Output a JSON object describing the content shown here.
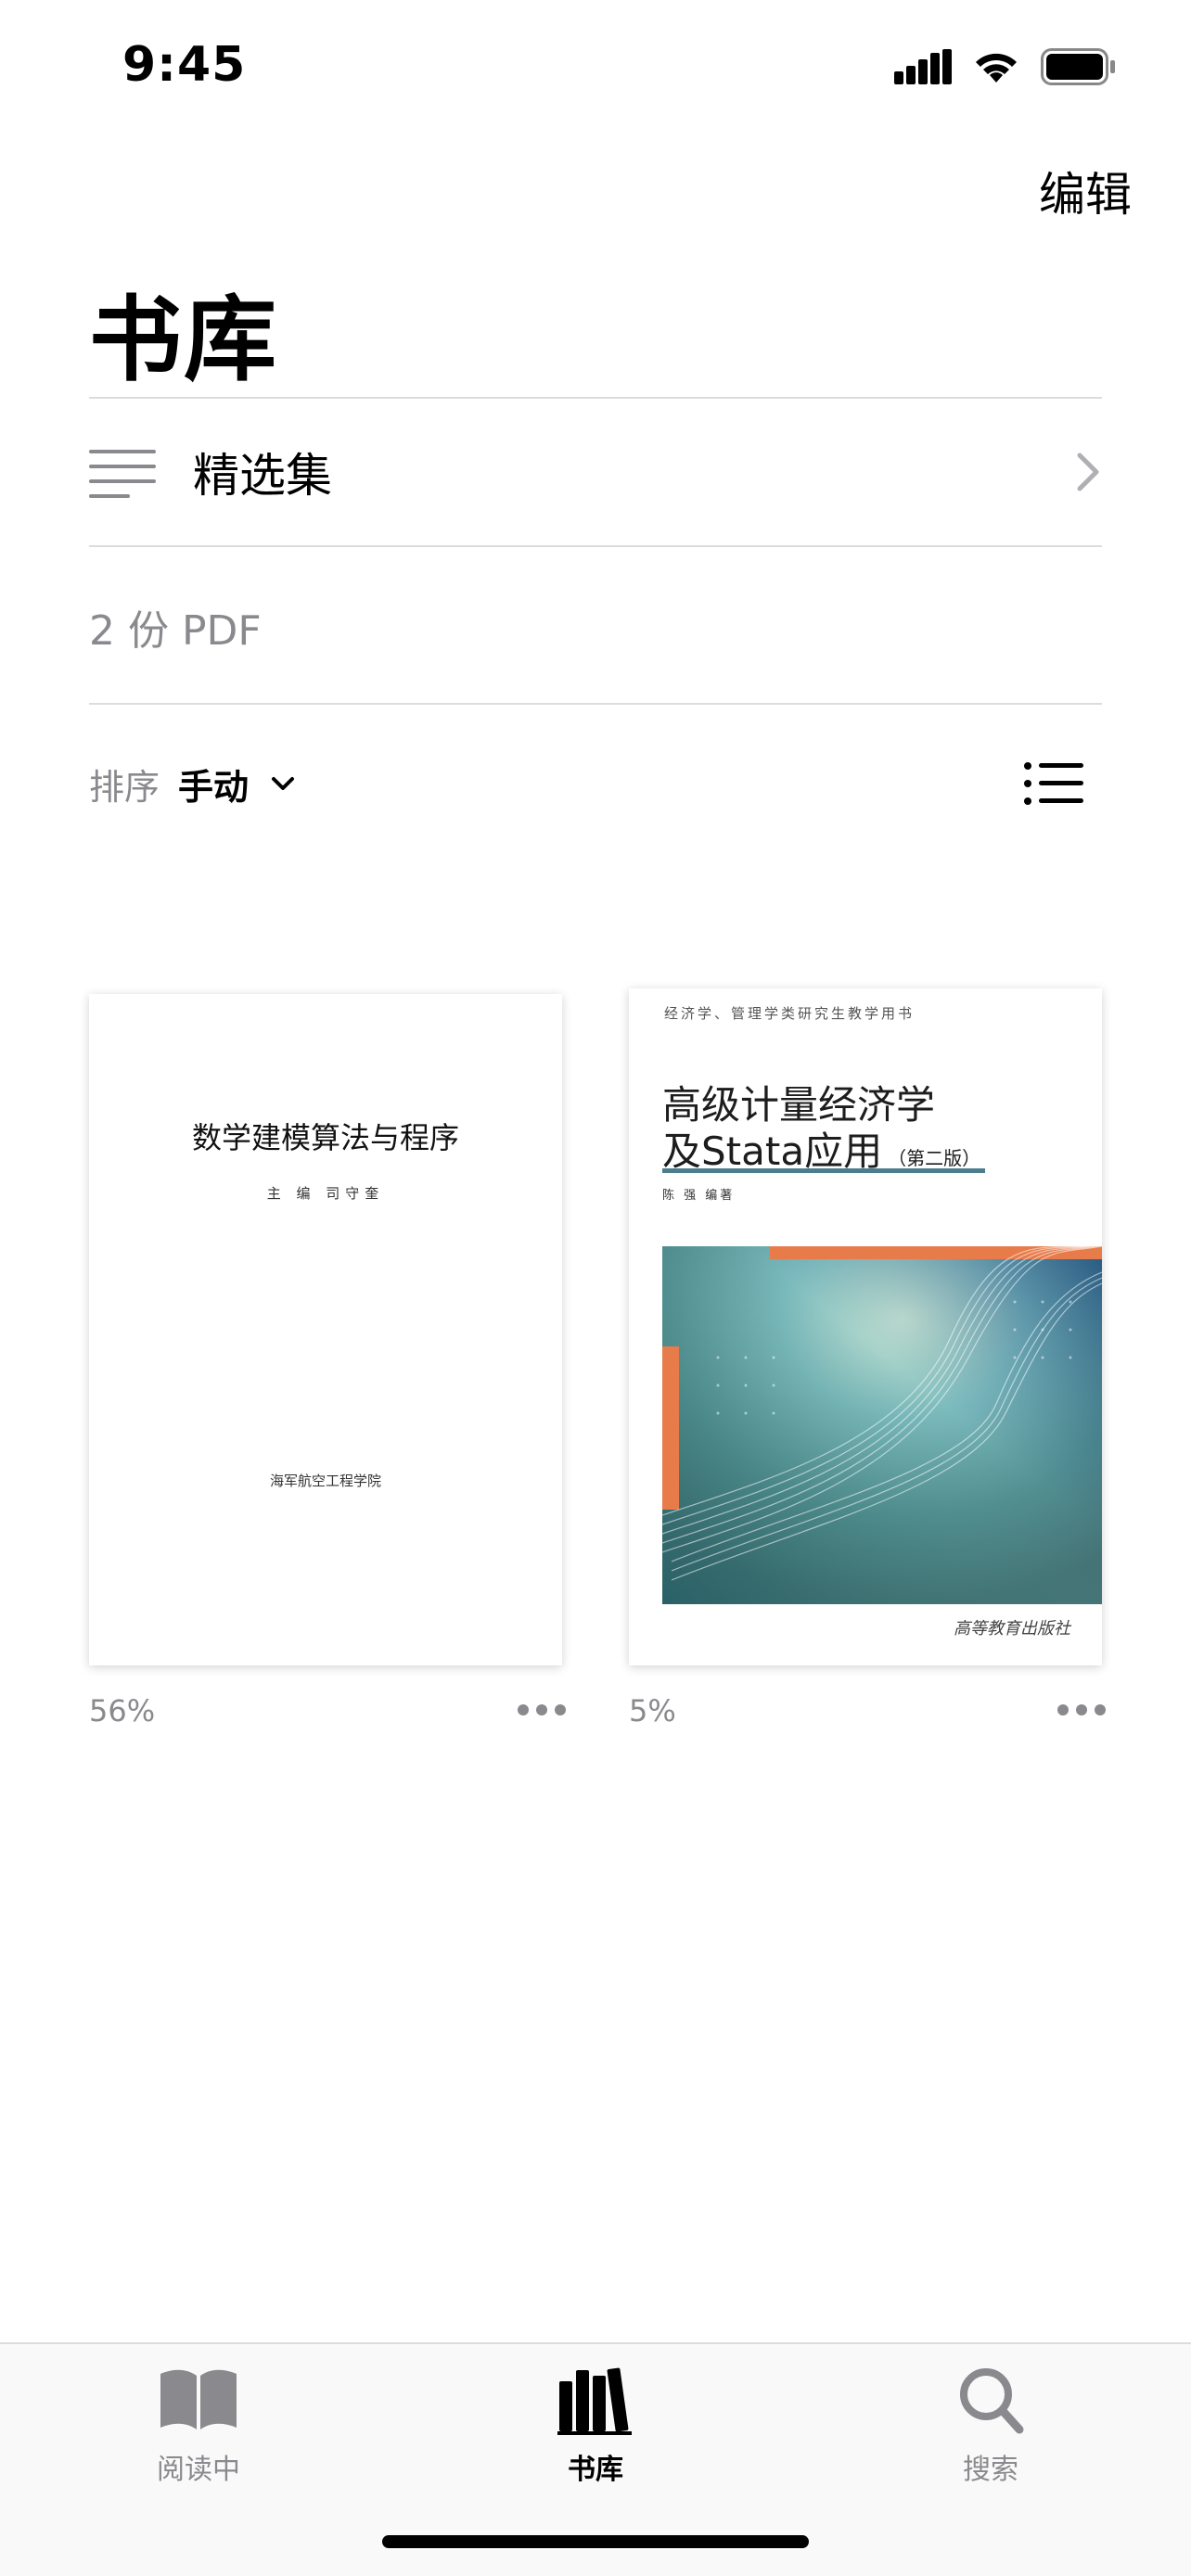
{
  "status_bar": {
    "time": "9:45"
  },
  "header": {
    "edit_label": "编辑",
    "title": "书库"
  },
  "collections": {
    "label": "精选集"
  },
  "library": {
    "pdf_count": "2 份 PDF"
  },
  "sort": {
    "label": "排序",
    "value": "手动"
  },
  "books": [
    {
      "cover_title": "数学建模算法与程序",
      "cover_editor": "主 编  司守奎",
      "cover_publisher": "海军航空工程学院",
      "progress": "56%"
    },
    {
      "cover_series": "经济学、管理学类研究生教学用书",
      "cover_title_line1": "高级计量经济学",
      "cover_title_line2": "及Stata应用",
      "cover_edition": "（第二版）",
      "cover_author": "陈 强  编著",
      "cover_publisher": "高等教育出版社",
      "progress": "5%"
    }
  ],
  "tab_bar": {
    "tabs": [
      {
        "label": "阅读中",
        "icon": "book-open-icon",
        "active": false
      },
      {
        "label": "书库",
        "icon": "books-icon",
        "active": true
      },
      {
        "label": "搜索",
        "icon": "search-icon",
        "active": false
      }
    ]
  },
  "colors": {
    "accent": "#000000",
    "secondary_text": "#8a8a8e",
    "divider": "#dcdcdc",
    "cover_underline": "#4b7d8c"
  }
}
